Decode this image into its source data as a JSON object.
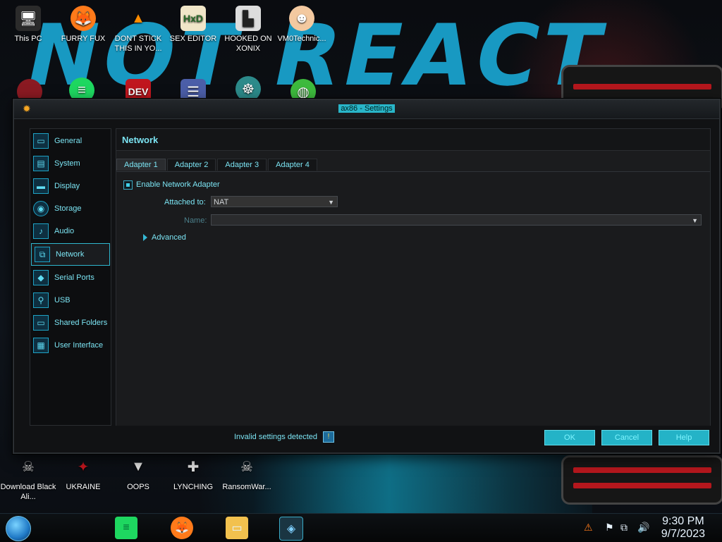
{
  "desktop": {
    "top_icons": [
      {
        "label": "This PC",
        "icon": "computer-icon"
      },
      {
        "label": "FURRY FUX",
        "icon": "firefox-icon"
      },
      {
        "label": "DONT STICK THIS IN YO...",
        "icon": "vlc-icon"
      },
      {
        "label": "SEX EDITOR",
        "icon": "hxd-icon"
      },
      {
        "label": "HOOKED ON XONIX",
        "icon": "game-icon"
      },
      {
        "label": "VM0Technic...",
        "icon": "doctor-icon"
      }
    ],
    "row2_icons": [
      {
        "label": "",
        "icon": "red-orb-icon"
      },
      {
        "label": "",
        "icon": "spotify-icon"
      },
      {
        "label": "DEV",
        "icon": "dev-icon"
      },
      {
        "label": "",
        "icon": "stack-icon"
      },
      {
        "label": "",
        "icon": "gecko-icon"
      },
      {
        "label": "",
        "icon": "lime-icon"
      }
    ],
    "bottom_icons": [
      {
        "label": "Download Black Ali...",
        "icon": "skull-icon"
      },
      {
        "label": "UKRAINE",
        "icon": "ukraine-icon"
      },
      {
        "label": "OOPS",
        "icon": "oops-icon"
      },
      {
        "label": "LYNCHING",
        "icon": "lynching-icon"
      },
      {
        "label": "RansomWar...",
        "icon": "skull-robot-icon"
      }
    ]
  },
  "window": {
    "title": "ax86 - Settings",
    "sidebar": [
      {
        "label": "General",
        "icon": "general-icon"
      },
      {
        "label": "System",
        "icon": "system-icon"
      },
      {
        "label": "Display",
        "icon": "display-icon"
      },
      {
        "label": "Storage",
        "icon": "storage-icon"
      },
      {
        "label": "Audio",
        "icon": "audio-icon"
      },
      {
        "label": "Network",
        "icon": "network-icon",
        "selected": true
      },
      {
        "label": "Serial Ports",
        "icon": "serial-ports-icon"
      },
      {
        "label": "USB",
        "icon": "usb-icon"
      },
      {
        "label": "Shared Folders",
        "icon": "shared-folders-icon"
      },
      {
        "label": "User Interface",
        "icon": "user-interface-icon"
      }
    ],
    "section_title": "Network",
    "tabs": [
      "Adapter 1",
      "Adapter 2",
      "Adapter 3",
      "Adapter 4"
    ],
    "active_tab": "Adapter 1",
    "enable_adapter_label": "Enable Network Adapter",
    "enable_adapter_checked": true,
    "attached_to_label": "Attached to:",
    "attached_to_value": "NAT",
    "name_label": "Name:",
    "name_value": "",
    "advanced_label": "Advanced",
    "status_text": "Invalid settings detected",
    "buttons": {
      "ok": "OK",
      "cancel": "Cancel",
      "help": "Help"
    }
  },
  "taskbar": {
    "time": "9:30 PM",
    "date": "9/7/2023",
    "apps": [
      "spotify-icon",
      "firefox-icon",
      "file-explorer-icon",
      "virtualbox-icon"
    ]
  }
}
